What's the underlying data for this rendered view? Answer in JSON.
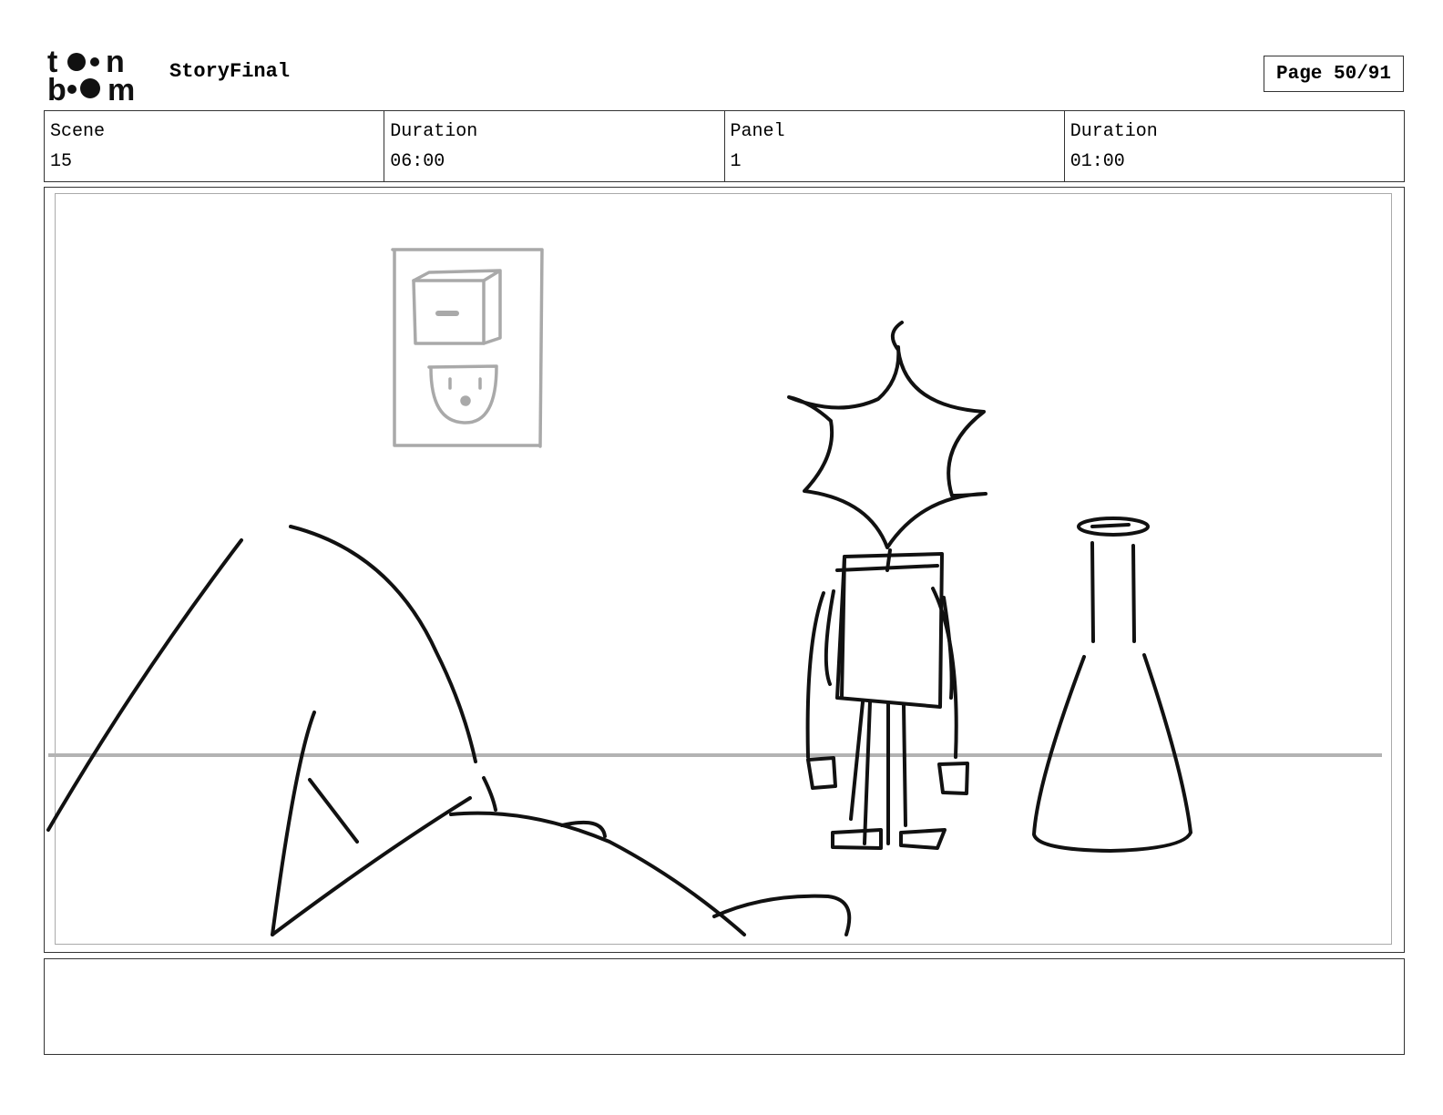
{
  "header": {
    "logo_text": "toon boom",
    "project_title": "StoryFinal",
    "page_label": "Page 50/91"
  },
  "info": {
    "scene_label": "Scene",
    "scene_value": "15",
    "scene_duration_label": "Duration",
    "scene_duration_value": "06:00",
    "panel_label": "Panel",
    "panel_value": "1",
    "panel_duration_label": "Duration",
    "panel_duration_value": "01:00"
  },
  "panel": {
    "sketch_color": "#111111",
    "guide_color": "#b3b3b3"
  },
  "notes": {
    "text": ""
  }
}
